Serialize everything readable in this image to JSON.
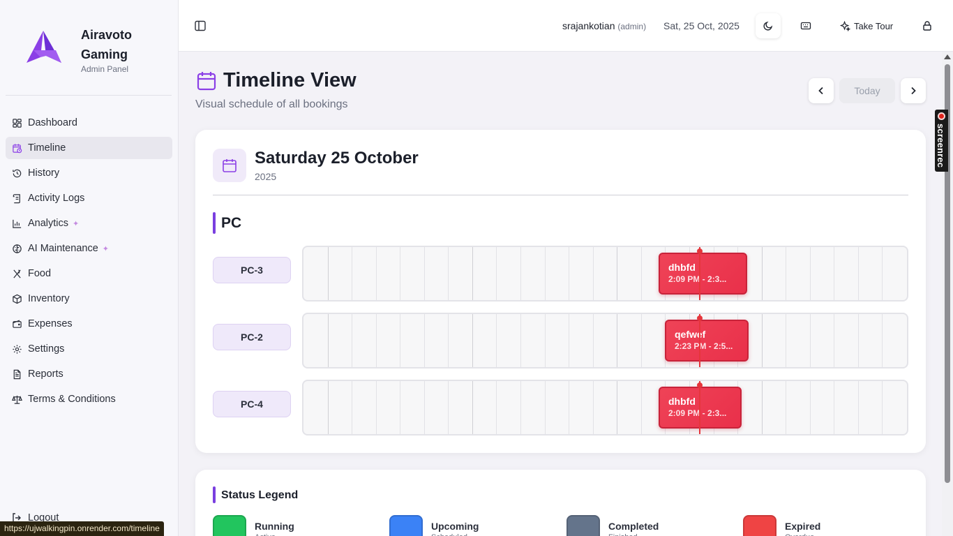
{
  "brand": {
    "name": "Airavoto Gaming",
    "subtitle": "Admin Panel",
    "accent": "#7a3fe0"
  },
  "sidebar": {
    "items": [
      {
        "label": "Dashboard",
        "icon": "dashboard-icon"
      },
      {
        "label": "Timeline",
        "icon": "calendar-clock-icon",
        "active": true
      },
      {
        "label": "History",
        "icon": "history-icon"
      },
      {
        "label": "Activity Logs",
        "icon": "scroll-log-icon"
      },
      {
        "label": "Analytics",
        "icon": "bar-chart-icon",
        "sparkle": true
      },
      {
        "label": "AI Maintenance",
        "icon": "brain-icon",
        "sparkle": true
      },
      {
        "label": "Food",
        "icon": "utensils-icon"
      },
      {
        "label": "Inventory",
        "icon": "package-icon"
      },
      {
        "label": "Expenses",
        "icon": "wallet-icon"
      },
      {
        "label": "Settings",
        "icon": "gear-icon"
      },
      {
        "label": "Reports",
        "icon": "file-text-icon"
      },
      {
        "label": "Terms & Conditions",
        "icon": "scale-icon"
      }
    ],
    "logout_label": "Logout"
  },
  "status_bar_url": "https://ujwalkingpin.onrender.com/timeline",
  "header": {
    "username": "srajankotian",
    "role": "(admin)",
    "date": "Sat, 25 Oct, 2025",
    "tour_label": "Take Tour"
  },
  "screenrec_label": "screenrec",
  "page": {
    "title": "Timeline View",
    "subtitle": "Visual schedule of all bookings",
    "today_label": "Today"
  },
  "day": {
    "title": "Saturday 25 October",
    "year": "2025"
  },
  "section": {
    "title": "PC"
  },
  "now_fraction": 0.655,
  "rows": [
    {
      "label": "PC-3",
      "bookings": [
        {
          "name": "dhbfd",
          "time": "2:09 PM - 2:3...",
          "start_fraction": 0.589,
          "end_fraction": 0.736
        }
      ]
    },
    {
      "label": "PC-2",
      "bookings": [
        {
          "name": "qefwef",
          "time": "2:23 PM - 2:5...",
          "start_fraction": 0.599,
          "end_fraction": 0.738
        }
      ]
    },
    {
      "label": "PC-4",
      "bookings": [
        {
          "name": "dhbfd",
          "time": "2:09 PM - 2:3...",
          "start_fraction": 0.589,
          "end_fraction": 0.727
        }
      ]
    }
  ],
  "legend": {
    "title": "Status Legend",
    "items": [
      {
        "name": "Running",
        "desc": "Active",
        "color": "#22c55e"
      },
      {
        "name": "Upcoming",
        "desc": "Scheduled",
        "color": "#3b82f6"
      },
      {
        "name": "Completed",
        "desc": "Finished",
        "color": "#64748b"
      },
      {
        "name": "Expired",
        "desc": "Overdue",
        "color": "#ef4444"
      }
    ]
  }
}
